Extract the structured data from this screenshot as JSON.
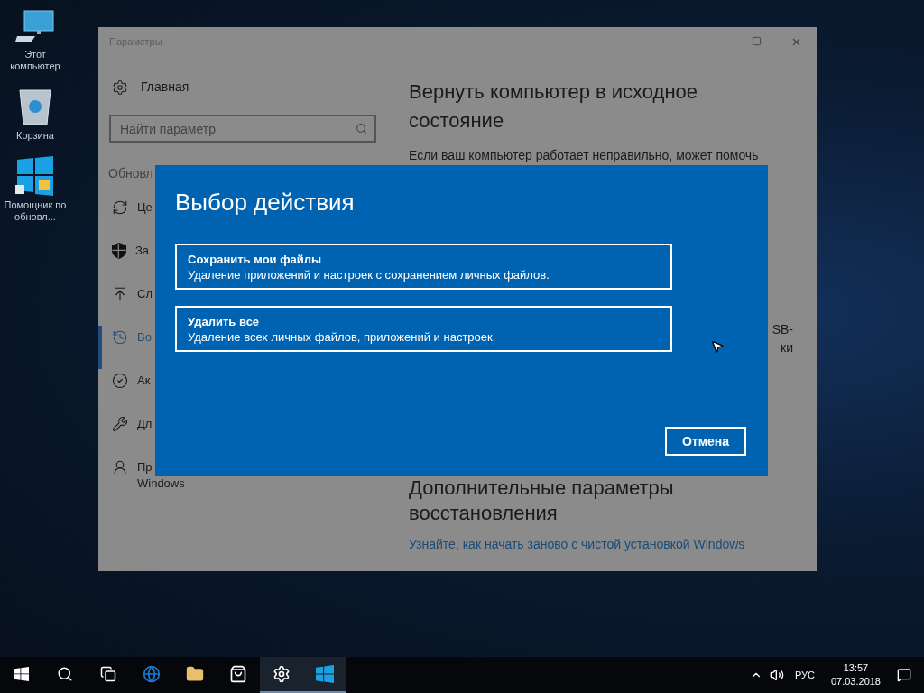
{
  "desktop_icons": [
    {
      "label": "Этот компьютер"
    },
    {
      "label": "Корзина"
    },
    {
      "label": "Помощник по обновл..."
    }
  ],
  "window": {
    "title": "Параметры",
    "sidebar": {
      "home": "Главная",
      "search": {
        "placeholder": "Найти параметр"
      },
      "section": "Обновл",
      "items": [
        {
          "label": "Це",
          "selected": false
        },
        {
          "label": "За",
          "selected": false
        },
        {
          "label": "Сл",
          "selected": false
        },
        {
          "label": "Во",
          "selected": true
        },
        {
          "label": "Ак",
          "selected": false
        },
        {
          "label": "Дл",
          "selected": false
        },
        {
          "label": "Пр",
          "label_2": "Windows",
          "selected": false
        }
      ]
    },
    "content": {
      "heading": "Вернуть компьютер в исходное состояние",
      "text": "Если ваш компьютер работает неправильно, может помочь",
      "fragment_1": "SB-",
      "fragment_2": "ки",
      "heading_2": "Дополнительные параметры восстановления",
      "link": "Узнайте, как начать заново с чистой установкой Windows"
    }
  },
  "dialog": {
    "title": "Выбор действия",
    "options": [
      {
        "title": "Сохранить мои файлы",
        "description": "Удаление приложений и настроек с сохранением личных файлов."
      },
      {
        "title": "Удалить все",
        "description": "Удаление всех личных файлов, приложений и настроек."
      }
    ],
    "cancel": "Отмена"
  },
  "taskbar": {
    "apps": [
      {
        "running": false
      },
      {
        "running": false
      },
      {
        "running": false
      },
      {
        "running": false
      },
      {
        "running": false
      },
      {
        "running": false
      },
      {
        "running": true
      },
      {
        "running": true
      }
    ],
    "language": "РУС",
    "time": "13:57",
    "date": "07.03.2018"
  }
}
